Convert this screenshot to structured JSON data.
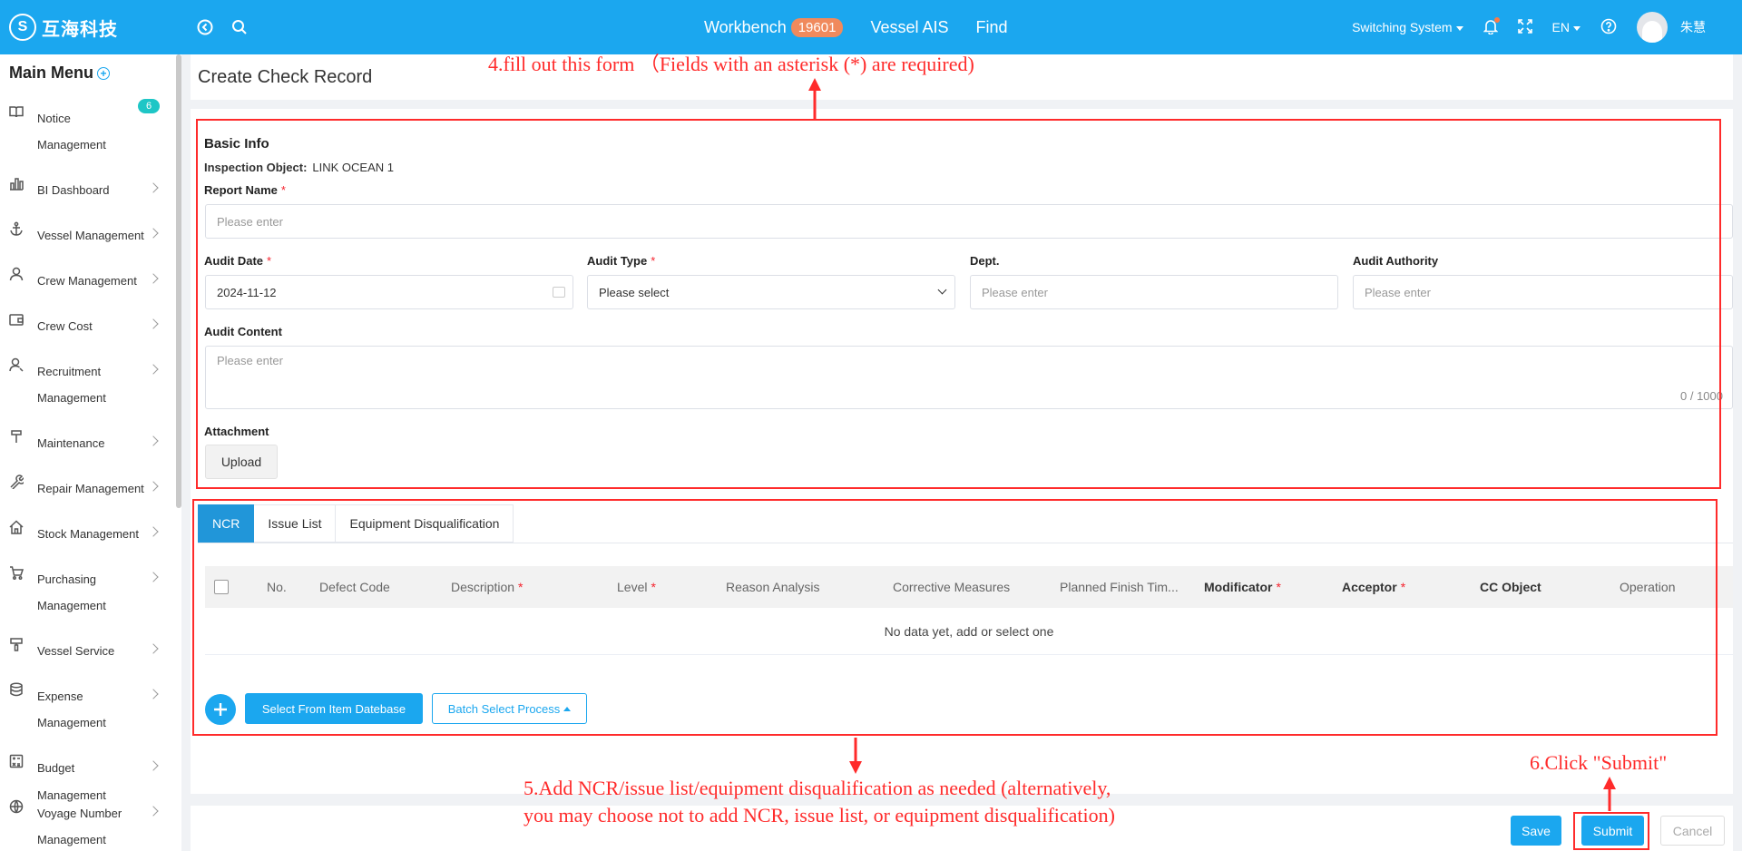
{
  "topbar": {
    "logo_mark": "S",
    "logo_text": "互海科技",
    "nav": {
      "workbench": "Workbench",
      "workbench_badge": "19601",
      "vessel_ais": "Vessel AIS",
      "find": "Find"
    },
    "switching_system": "Switching System",
    "language": "EN",
    "username": "朱慧"
  },
  "sidebar": {
    "title": "Main Menu",
    "notice_badge": "6",
    "items": [
      {
        "label": "Notice",
        "label2": "Management",
        "icon": "book-icon"
      },
      {
        "label": "BI Dashboard",
        "icon": "chart-icon"
      },
      {
        "label": "Vessel Management",
        "icon": "anchor-icon"
      },
      {
        "label": "Crew Management",
        "icon": "person-icon"
      },
      {
        "label": "Crew Cost",
        "icon": "wallet-icon"
      },
      {
        "label": "Recruitment",
        "label2": "Management",
        "icon": "recruit-icon"
      },
      {
        "label": "Maintenance",
        "icon": "hammer-icon"
      },
      {
        "label": "Repair Management",
        "icon": "wrench-icon"
      },
      {
        "label": "Stock Management",
        "icon": "home-icon"
      },
      {
        "label": "Purchasing",
        "label2": "Management",
        "icon": "cart-icon"
      },
      {
        "label": "Vessel Service",
        "icon": "brush-icon"
      },
      {
        "label": "Expense",
        "label2": "Management",
        "icon": "database-icon"
      },
      {
        "label": "Budget Management",
        "icon": "calculator-icon"
      },
      {
        "label": "Voyage Number",
        "label2": "Management",
        "icon": "globe-icon"
      }
    ]
  },
  "page": {
    "title": "Create Check Record"
  },
  "form": {
    "section_title": "Basic Info",
    "inspection_object_label": "Inspection Object:",
    "inspection_object_value": "LINK OCEAN 1",
    "report_name_label": "Report Name",
    "report_name_placeholder": "Please enter",
    "audit_date_label": "Audit Date",
    "audit_date_value": "2024-11-12",
    "audit_type_label": "Audit Type",
    "audit_type_value": "Please select",
    "dept_label": "Dept.",
    "dept_placeholder": "Please enter",
    "audit_authority_label": "Audit Authority",
    "audit_authority_placeholder": "Please enter",
    "audit_content_label": "Audit Content",
    "audit_content_placeholder": "Please enter",
    "audit_content_counter": "0 / 1000",
    "attachment_label": "Attachment",
    "upload_button": "Upload",
    "required_mark": "*"
  },
  "tabs": [
    "NCR",
    "Issue List",
    "Equipment Disqualification"
  ],
  "table": {
    "columns": [
      {
        "label": "No.",
        "required": false,
        "bold": false
      },
      {
        "label": "Defect Code",
        "required": false,
        "bold": false
      },
      {
        "label": "Description",
        "required": true,
        "bold": false
      },
      {
        "label": "Level",
        "required": true,
        "bold": false
      },
      {
        "label": "Reason Analysis",
        "required": false,
        "bold": false
      },
      {
        "label": "Corrective Measures",
        "required": false,
        "bold": false
      },
      {
        "label": "Planned Finish Tim...",
        "required": false,
        "bold": false
      },
      {
        "label": "Modificator",
        "required": true,
        "bold": true
      },
      {
        "label": "Acceptor",
        "required": true,
        "bold": true
      },
      {
        "label": "CC Object",
        "required": false,
        "bold": true
      },
      {
        "label": "Operation",
        "required": false,
        "bold": false
      }
    ],
    "empty_text": "No data yet, add or select one"
  },
  "actions": {
    "select_from_db": "Select From Item Datebase",
    "batch_select": "Batch Select Process",
    "save": "Save",
    "submit": "Submit",
    "cancel": "Cancel"
  },
  "annotations": {
    "step4": "4.fill out this form （Fields with an asterisk (*) are required)",
    "step5_line1": "5.Add NCR/issue list/equipment disqualification as needed (alternatively,",
    "step5_line2": "you may choose not to add NCR, issue list, or equipment disqualification)",
    "step6": "6.Click \"Submit\""
  },
  "colors": {
    "brand": "#1ba7ef",
    "annotation": "#ff2b2b",
    "badge": "#f08a5d"
  }
}
